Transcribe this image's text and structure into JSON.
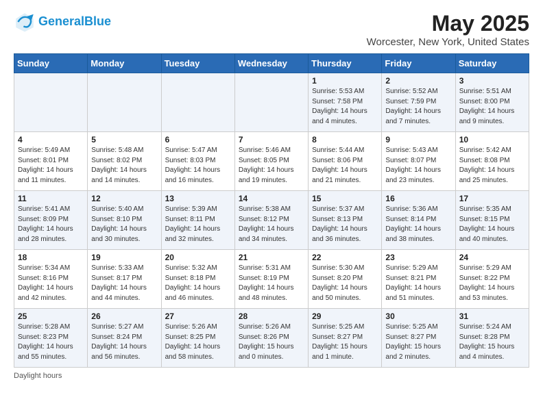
{
  "header": {
    "logo_line1": "General",
    "logo_line2": "Blue",
    "title": "May 2025",
    "subtitle": "Worcester, New York, United States"
  },
  "days_of_week": [
    "Sunday",
    "Monday",
    "Tuesday",
    "Wednesday",
    "Thursday",
    "Friday",
    "Saturday"
  ],
  "footer": {
    "note": "Daylight hours"
  },
  "weeks": [
    [
      {
        "day": "",
        "info": ""
      },
      {
        "day": "",
        "info": ""
      },
      {
        "day": "",
        "info": ""
      },
      {
        "day": "",
        "info": ""
      },
      {
        "day": "1",
        "info": "Sunrise: 5:53 AM\nSunset: 7:58 PM\nDaylight: 14 hours\nand 4 minutes."
      },
      {
        "day": "2",
        "info": "Sunrise: 5:52 AM\nSunset: 7:59 PM\nDaylight: 14 hours\nand 7 minutes."
      },
      {
        "day": "3",
        "info": "Sunrise: 5:51 AM\nSunset: 8:00 PM\nDaylight: 14 hours\nand 9 minutes."
      }
    ],
    [
      {
        "day": "4",
        "info": "Sunrise: 5:49 AM\nSunset: 8:01 PM\nDaylight: 14 hours\nand 11 minutes."
      },
      {
        "day": "5",
        "info": "Sunrise: 5:48 AM\nSunset: 8:02 PM\nDaylight: 14 hours\nand 14 minutes."
      },
      {
        "day": "6",
        "info": "Sunrise: 5:47 AM\nSunset: 8:03 PM\nDaylight: 14 hours\nand 16 minutes."
      },
      {
        "day": "7",
        "info": "Sunrise: 5:46 AM\nSunset: 8:05 PM\nDaylight: 14 hours\nand 19 minutes."
      },
      {
        "day": "8",
        "info": "Sunrise: 5:44 AM\nSunset: 8:06 PM\nDaylight: 14 hours\nand 21 minutes."
      },
      {
        "day": "9",
        "info": "Sunrise: 5:43 AM\nSunset: 8:07 PM\nDaylight: 14 hours\nand 23 minutes."
      },
      {
        "day": "10",
        "info": "Sunrise: 5:42 AM\nSunset: 8:08 PM\nDaylight: 14 hours\nand 25 minutes."
      }
    ],
    [
      {
        "day": "11",
        "info": "Sunrise: 5:41 AM\nSunset: 8:09 PM\nDaylight: 14 hours\nand 28 minutes."
      },
      {
        "day": "12",
        "info": "Sunrise: 5:40 AM\nSunset: 8:10 PM\nDaylight: 14 hours\nand 30 minutes."
      },
      {
        "day": "13",
        "info": "Sunrise: 5:39 AM\nSunset: 8:11 PM\nDaylight: 14 hours\nand 32 minutes."
      },
      {
        "day": "14",
        "info": "Sunrise: 5:38 AM\nSunset: 8:12 PM\nDaylight: 14 hours\nand 34 minutes."
      },
      {
        "day": "15",
        "info": "Sunrise: 5:37 AM\nSunset: 8:13 PM\nDaylight: 14 hours\nand 36 minutes."
      },
      {
        "day": "16",
        "info": "Sunrise: 5:36 AM\nSunset: 8:14 PM\nDaylight: 14 hours\nand 38 minutes."
      },
      {
        "day": "17",
        "info": "Sunrise: 5:35 AM\nSunset: 8:15 PM\nDaylight: 14 hours\nand 40 minutes."
      }
    ],
    [
      {
        "day": "18",
        "info": "Sunrise: 5:34 AM\nSunset: 8:16 PM\nDaylight: 14 hours\nand 42 minutes."
      },
      {
        "day": "19",
        "info": "Sunrise: 5:33 AM\nSunset: 8:17 PM\nDaylight: 14 hours\nand 44 minutes."
      },
      {
        "day": "20",
        "info": "Sunrise: 5:32 AM\nSunset: 8:18 PM\nDaylight: 14 hours\nand 46 minutes."
      },
      {
        "day": "21",
        "info": "Sunrise: 5:31 AM\nSunset: 8:19 PM\nDaylight: 14 hours\nand 48 minutes."
      },
      {
        "day": "22",
        "info": "Sunrise: 5:30 AM\nSunset: 8:20 PM\nDaylight: 14 hours\nand 50 minutes."
      },
      {
        "day": "23",
        "info": "Sunrise: 5:29 AM\nSunset: 8:21 PM\nDaylight: 14 hours\nand 51 minutes."
      },
      {
        "day": "24",
        "info": "Sunrise: 5:29 AM\nSunset: 8:22 PM\nDaylight: 14 hours\nand 53 minutes."
      }
    ],
    [
      {
        "day": "25",
        "info": "Sunrise: 5:28 AM\nSunset: 8:23 PM\nDaylight: 14 hours\nand 55 minutes."
      },
      {
        "day": "26",
        "info": "Sunrise: 5:27 AM\nSunset: 8:24 PM\nDaylight: 14 hours\nand 56 minutes."
      },
      {
        "day": "27",
        "info": "Sunrise: 5:26 AM\nSunset: 8:25 PM\nDaylight: 14 hours\nand 58 minutes."
      },
      {
        "day": "28",
        "info": "Sunrise: 5:26 AM\nSunset: 8:26 PM\nDaylight: 15 hours\nand 0 minutes."
      },
      {
        "day": "29",
        "info": "Sunrise: 5:25 AM\nSunset: 8:27 PM\nDaylight: 15 hours\nand 1 minute."
      },
      {
        "day": "30",
        "info": "Sunrise: 5:25 AM\nSunset: 8:27 PM\nDaylight: 15 hours\nand 2 minutes."
      },
      {
        "day": "31",
        "info": "Sunrise: 5:24 AM\nSunset: 8:28 PM\nDaylight: 15 hours\nand 4 minutes."
      }
    ]
  ]
}
